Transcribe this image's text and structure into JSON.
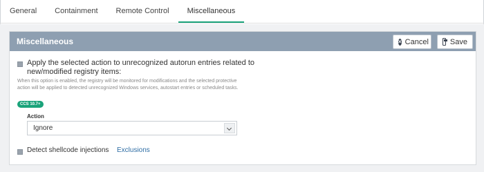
{
  "tabs": [
    {
      "label": "General"
    },
    {
      "label": "Containment"
    },
    {
      "label": "Remote Control"
    },
    {
      "label": "Miscellaneous",
      "active": true
    }
  ],
  "panel": {
    "title": "Miscellaneous",
    "cancel_label": "Cancel",
    "save_label": "Save"
  },
  "option_autorun": {
    "checked": true,
    "label": "Apply the selected action to unrecognized autorun entries related to new/modified registry items:",
    "description": "When this option is enabled, the registry will be monitored for modifications and the selected protective action will be applied to detected unrecognized Windows services, autostart entries or scheduled tasks.",
    "badge": "CCS 10.7+",
    "action_label": "Action",
    "action_value": "Ignore"
  },
  "option_shellcode": {
    "checked": true,
    "label": "Detect shellcode injections",
    "link": "Exclusions"
  },
  "colors": {
    "accent": "#1aa37a",
    "header_bg": "#8e9fb1",
    "link": "#2e6da4"
  },
  "icons": {
    "cancel": "close-circle-icon",
    "save": "save-icon",
    "select": "chevron-down-icon"
  }
}
